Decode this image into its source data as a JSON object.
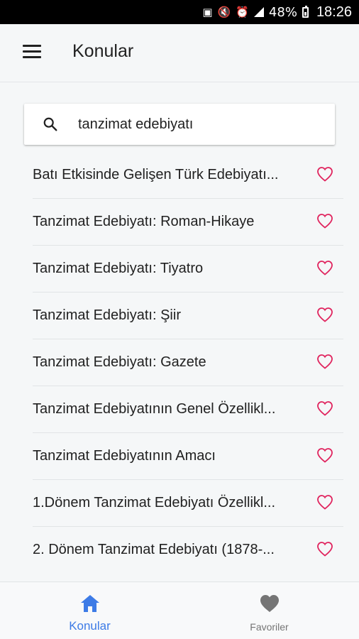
{
  "status_bar": {
    "battery": "48%",
    "time": "18:26"
  },
  "app_bar": {
    "title": "Konular"
  },
  "search": {
    "value": "tanzimat edebiyatı"
  },
  "topics": [
    {
      "label": "Batı Etkisinde Gelişen Türk Edebiyatı...",
      "favorite": false
    },
    {
      "label": "Tanzimat Edebiyatı: Roman-Hikaye",
      "favorite": false
    },
    {
      "label": "Tanzimat Edebiyatı: Tiyatro",
      "favorite": false
    },
    {
      "label": "Tanzimat Edebiyatı: Şiir",
      "favorite": false
    },
    {
      "label": "Tanzimat Edebiyatı: Gazete",
      "favorite": false
    },
    {
      "label": "Tanzimat Edebiyatının Genel Özellikl...",
      "favorite": false
    },
    {
      "label": "Tanzimat Edebiyatının Amacı",
      "favorite": false
    },
    {
      "label": "1.Dönem Tanzimat Edebiyatı Özellikl...",
      "favorite": false
    },
    {
      "label": "2. Dönem Tanzimat Edebiyatı (1878-...",
      "favorite": false
    }
  ],
  "bottom_nav": {
    "items": [
      {
        "label": "Konular",
        "icon": "home-icon",
        "active": true
      },
      {
        "label": "Favoriler",
        "icon": "heart-icon",
        "active": false
      }
    ]
  },
  "colors": {
    "accent": "#3d7be6",
    "heart": "#e0245e",
    "inactive": "#757575",
    "background": "#f5f7f8"
  }
}
